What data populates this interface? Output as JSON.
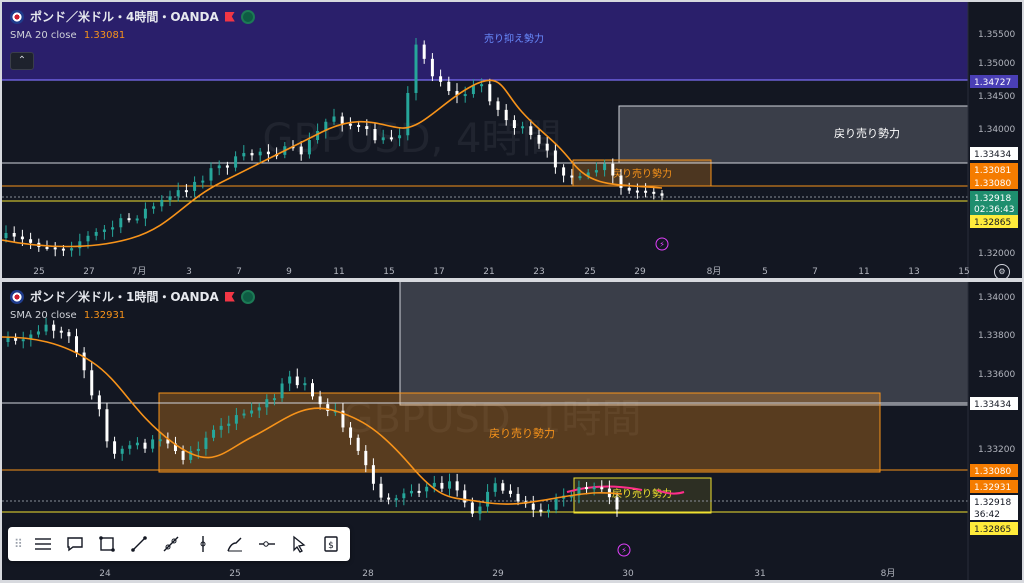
{
  "colors": {
    "background": "#131722",
    "bull": "#26a69a",
    "bear": "#ffffff",
    "sma": "#f7931a",
    "resistance_band": "#2a1f6b",
    "orange_zone": "#f7931a",
    "yellow_zone": "#f0e130",
    "last_price_tag": "#1e8e6e",
    "sma_tag": "#f57c00",
    "level_tag": "#ffeb3b"
  },
  "top_chart": {
    "title": "ポンド／米ドル・4時間・OANDA",
    "sma_label": "SMA 20 close",
    "sma_value": "1.33081",
    "watermark": "GBPUSD, 4時間",
    "annotations": [
      "売り抑え勢力",
      "戻り売り勢力",
      "戻り売り勢力"
    ],
    "price_labels": [
      "1.35500",
      "1.35000",
      "1.34500",
      "1.34000",
      "1.32000"
    ],
    "price_tags": [
      {
        "text": "1.34727",
        "kind": "purple"
      },
      {
        "text": "1.33434",
        "kind": "white"
      },
      {
        "text": "1.33081",
        "kind": "orange"
      },
      {
        "text": "1.33080",
        "kind": "orange"
      },
      {
        "text": "1.32918",
        "kind": "green"
      },
      {
        "text": "02:36:43",
        "kind": "green"
      },
      {
        "text": "1.32865",
        "kind": "yellow"
      }
    ],
    "time_labels": [
      "25",
      "27",
      "7月",
      "3",
      "7",
      "9",
      "11",
      "15",
      "17",
      "21",
      "23",
      "25",
      "29",
      "8月",
      "5",
      "7",
      "11",
      "13",
      "15"
    ]
  },
  "bottom_chart": {
    "title": "ポンド／米ドル・1時間・OANDA",
    "sma_label": "SMA 20 close",
    "sma_value": "1.32931",
    "watermark": "GBPUSD, 1時間",
    "annotations": [
      "戻り売り勢力",
      "戻り売り勢力"
    ],
    "price_labels": [
      "1.34000",
      "1.33800",
      "1.33600",
      "1.33200"
    ],
    "price_tags": [
      {
        "text": "1.33434",
        "kind": "white"
      },
      {
        "text": "1.33080",
        "kind": "orange"
      },
      {
        "text": "1.32931",
        "kind": "orange"
      },
      {
        "text": "1.32918",
        "kind": "white"
      },
      {
        "text": "36:42",
        "kind": "white"
      },
      {
        "text": "1.32865",
        "kind": "yellow"
      }
    ],
    "time_labels": [
      "24",
      "25",
      "28",
      "29",
      "30",
      "31",
      "8月"
    ]
  },
  "toolbar": {
    "tools": [
      "lines-icon",
      "comment-icon",
      "rectangle-icon",
      "trendline-icon",
      "channel-icon",
      "vertical-line-icon",
      "brush-icon",
      "horizontal-ray-icon",
      "cursor-icon",
      "price-range-icon"
    ]
  }
}
